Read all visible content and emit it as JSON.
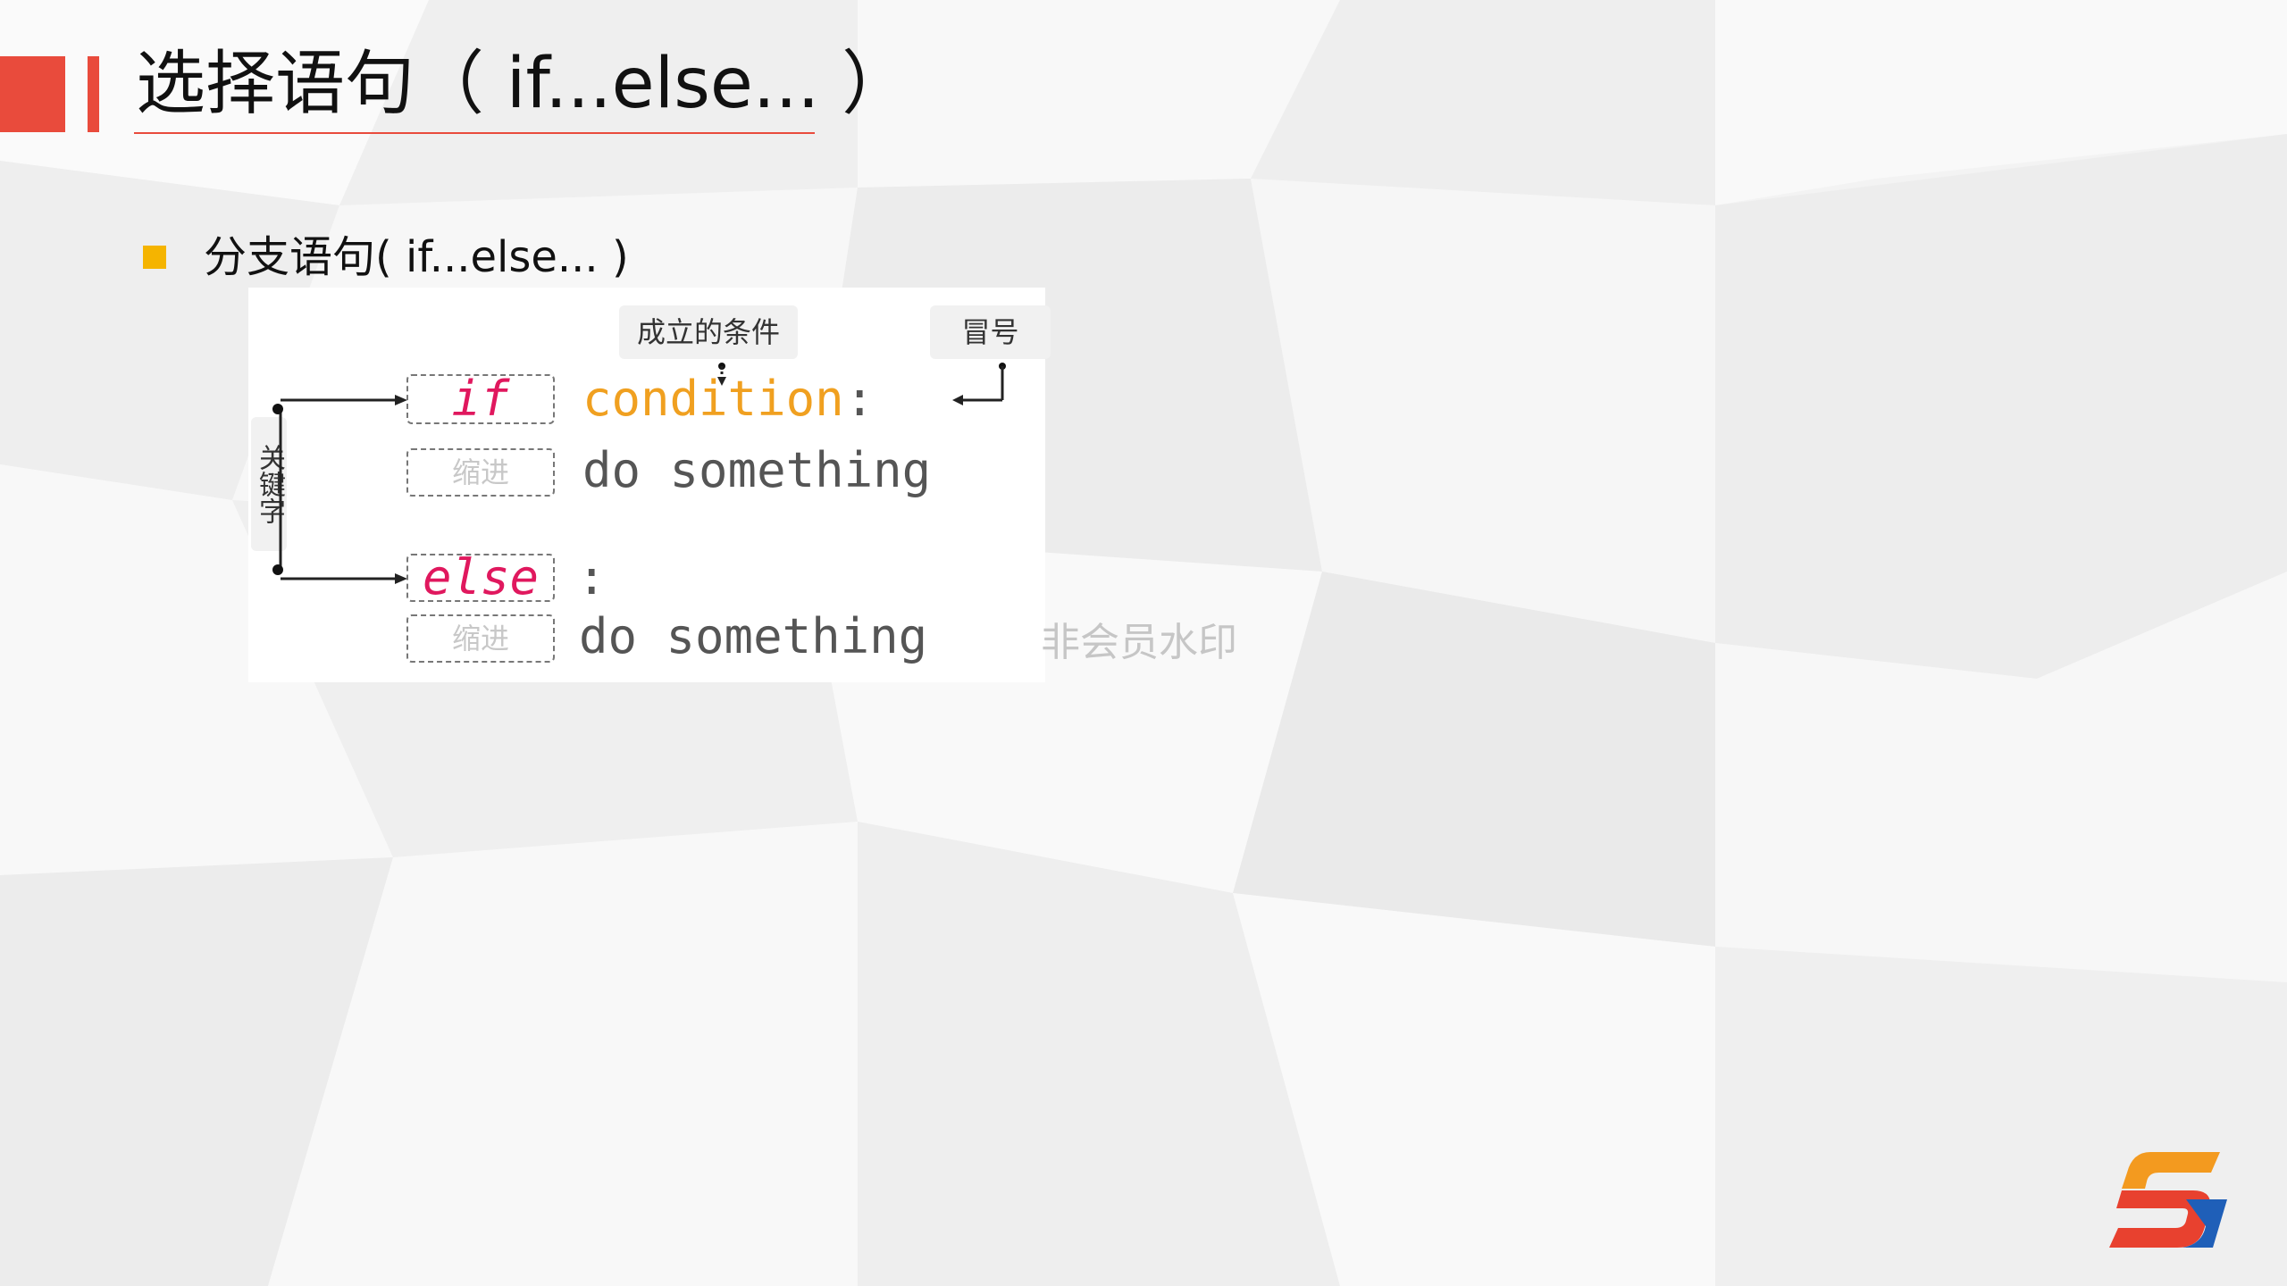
{
  "slide": {
    "title": "选择语句（ if...else... ）",
    "bullet": "分支语句( if...else... )",
    "watermark": "非会员水印",
    "colors": {
      "accent_red": "#e94b3c",
      "bullet_yellow": "#f5b400",
      "keyword_pink": "#e0185e",
      "condition_orange": "#f0a020",
      "code_gray": "#555555"
    }
  },
  "diagram": {
    "tag_condition": "成立的条件",
    "tag_colon": "冒号",
    "tag_keyword": "关键字",
    "if_keyword": "if",
    "condition": "condition",
    "colon": ":",
    "indent_label": "缩进",
    "body_code": "do something",
    "else_keyword": "else",
    "else_colon": ":"
  },
  "logo": {
    "icon": "s-logo-icon"
  }
}
